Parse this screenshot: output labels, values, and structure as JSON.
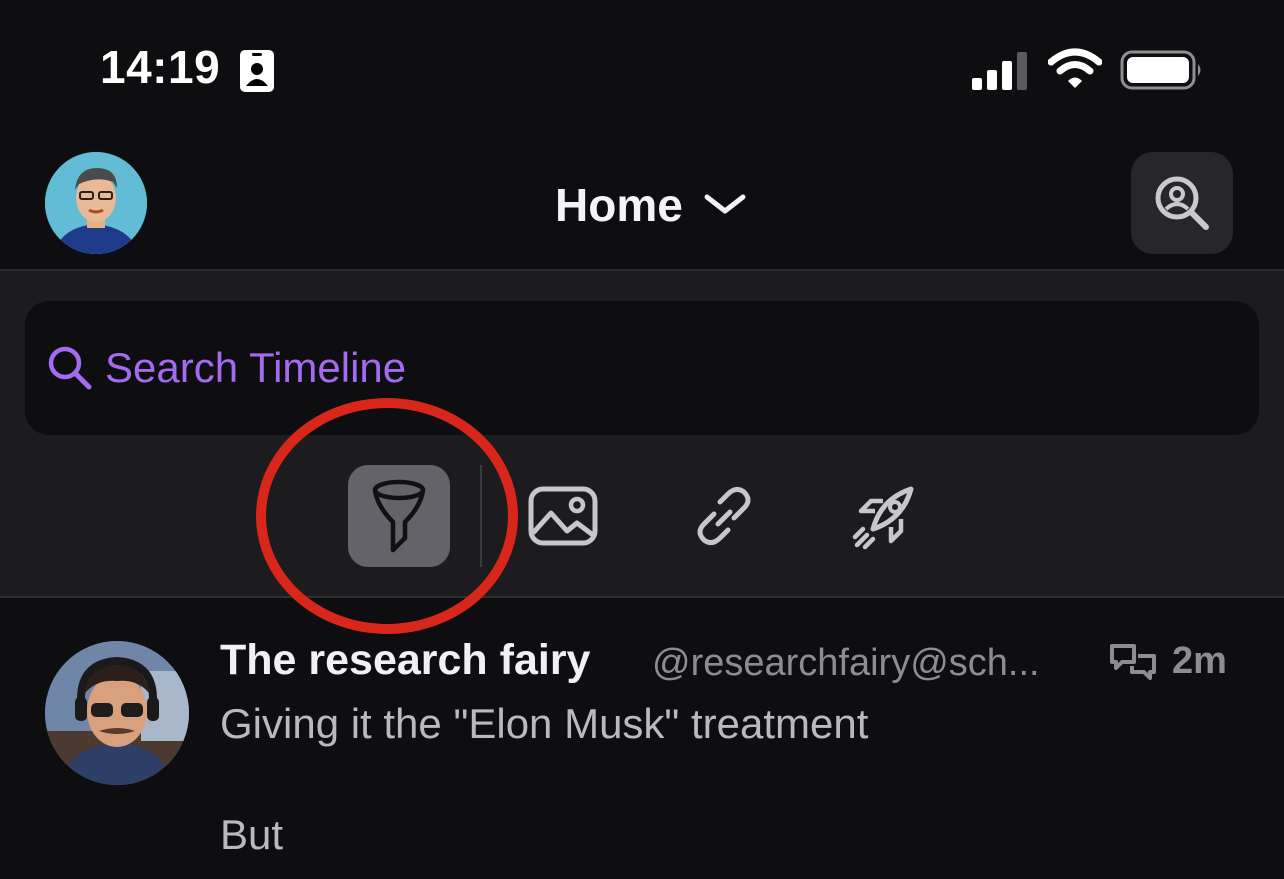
{
  "status_bar": {
    "time": "14:19",
    "icons": [
      "contact-card-icon",
      "signal-icon",
      "wifi-icon",
      "battery-icon"
    ]
  },
  "header": {
    "title": "Home",
    "title_icon": "chevron-down-icon",
    "search_icon": "search-profile-icon"
  },
  "search": {
    "placeholder": "Search Timeline",
    "icon": "search-icon",
    "accent_color": "#a46bf0"
  },
  "filters": [
    {
      "icon": "funnel-icon",
      "active": true
    },
    {
      "icon": "media-icon",
      "active": false
    },
    {
      "icon": "link-icon",
      "active": false
    },
    {
      "icon": "rocket-icon",
      "active": false
    }
  ],
  "annotation": {
    "shape": "circle",
    "color": "#d8261a"
  },
  "post": {
    "author": "The research fairy",
    "handle": "@researchfairy@sch...",
    "time": "2m",
    "reply_icon": "conversation-icon",
    "body": [
      "Giving it the \"Elon Musk\" treatment",
      "But"
    ]
  }
}
